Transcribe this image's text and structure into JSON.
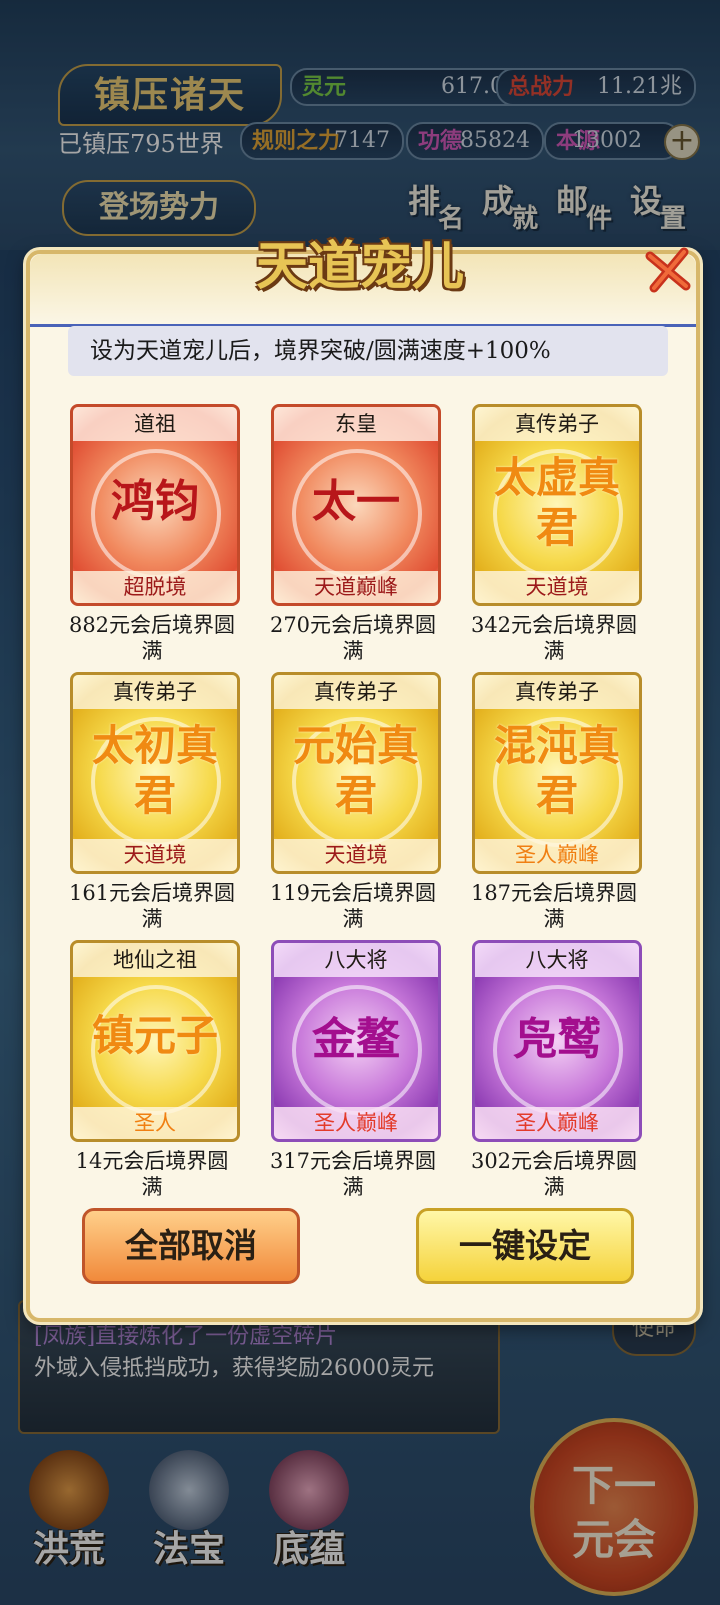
{
  "hud": {
    "title": "镇压诸天",
    "world_label": "已镇压795世界",
    "stats": [
      {
        "key": "灵元",
        "value": "617.05万",
        "color": "#7fd34a"
      },
      {
        "key": "总战力",
        "value": "11.21兆",
        "color": "#e24a3a"
      },
      {
        "key": "规则之力",
        "value": "7147",
        "color": "#e6a93a"
      },
      {
        "key": "功德",
        "value": "85824",
        "color": "#d95dc1"
      },
      {
        "key": "本源",
        "value": "13002",
        "color": "#d95dc1"
      }
    ],
    "faction_button": "登场势力",
    "nav": [
      {
        "a": "排",
        "b": "名"
      },
      {
        "a": "成",
        "b": "就"
      },
      {
        "a": "邮",
        "b": "件"
      },
      {
        "a": "设",
        "b": "置"
      }
    ]
  },
  "dialog": {
    "title": "天道宠儿",
    "banner": "设为天道宠儿后，境界突破/圆满速度+100%",
    "cards": [
      {
        "rank": "道祖",
        "name": "鸿钧",
        "realm": "超脱境",
        "caption": "882元会后境界圆满",
        "style": "red"
      },
      {
        "rank": "东皇",
        "name": "太一",
        "realm": "天道巅峰",
        "caption": "270元会后境界圆满",
        "style": "red"
      },
      {
        "rank": "真传弟子",
        "name": "太虚真君",
        "realm": "天道境",
        "caption": "342元会后境界圆满",
        "style": "gold"
      },
      {
        "rank": "真传弟子",
        "name": "太初真君",
        "realm": "天道境",
        "caption": "161元会后境界圆满",
        "style": "gold"
      },
      {
        "rank": "真传弟子",
        "name": "元始真君",
        "realm": "天道境",
        "caption": "119元会后境界圆满",
        "style": "gold"
      },
      {
        "rank": "真传弟子",
        "name": "混沌真君",
        "realm": "圣人巅峰",
        "caption": "187元会后境界圆满",
        "style": "gold"
      },
      {
        "rank": "地仙之祖",
        "name": "镇元子",
        "realm": "圣人",
        "caption": "14元会后境界圆满",
        "style": "gold"
      },
      {
        "rank": "八大将",
        "name": "金鳌",
        "realm": "圣人巅峰",
        "caption": "317元会后境界圆满",
        "style": "purple"
      },
      {
        "rank": "八大将",
        "name": "凫鹫",
        "realm": "圣人巅峰",
        "caption": "302元会后境界圆满",
        "style": "purple"
      }
    ],
    "cancel_all": "全部取消",
    "one_key_set": "一键设定"
  },
  "log": {
    "line1": "[凤族]直接炼化了一份虚空碎片",
    "line2": "外域入侵抵挡成功，获得奖励26000灵元"
  },
  "side_button": "使命",
  "next_button": {
    "line1": "下一",
    "line2": "元会"
  },
  "bottom_nav": [
    "洪荒",
    "法宝",
    "底蕴"
  ]
}
